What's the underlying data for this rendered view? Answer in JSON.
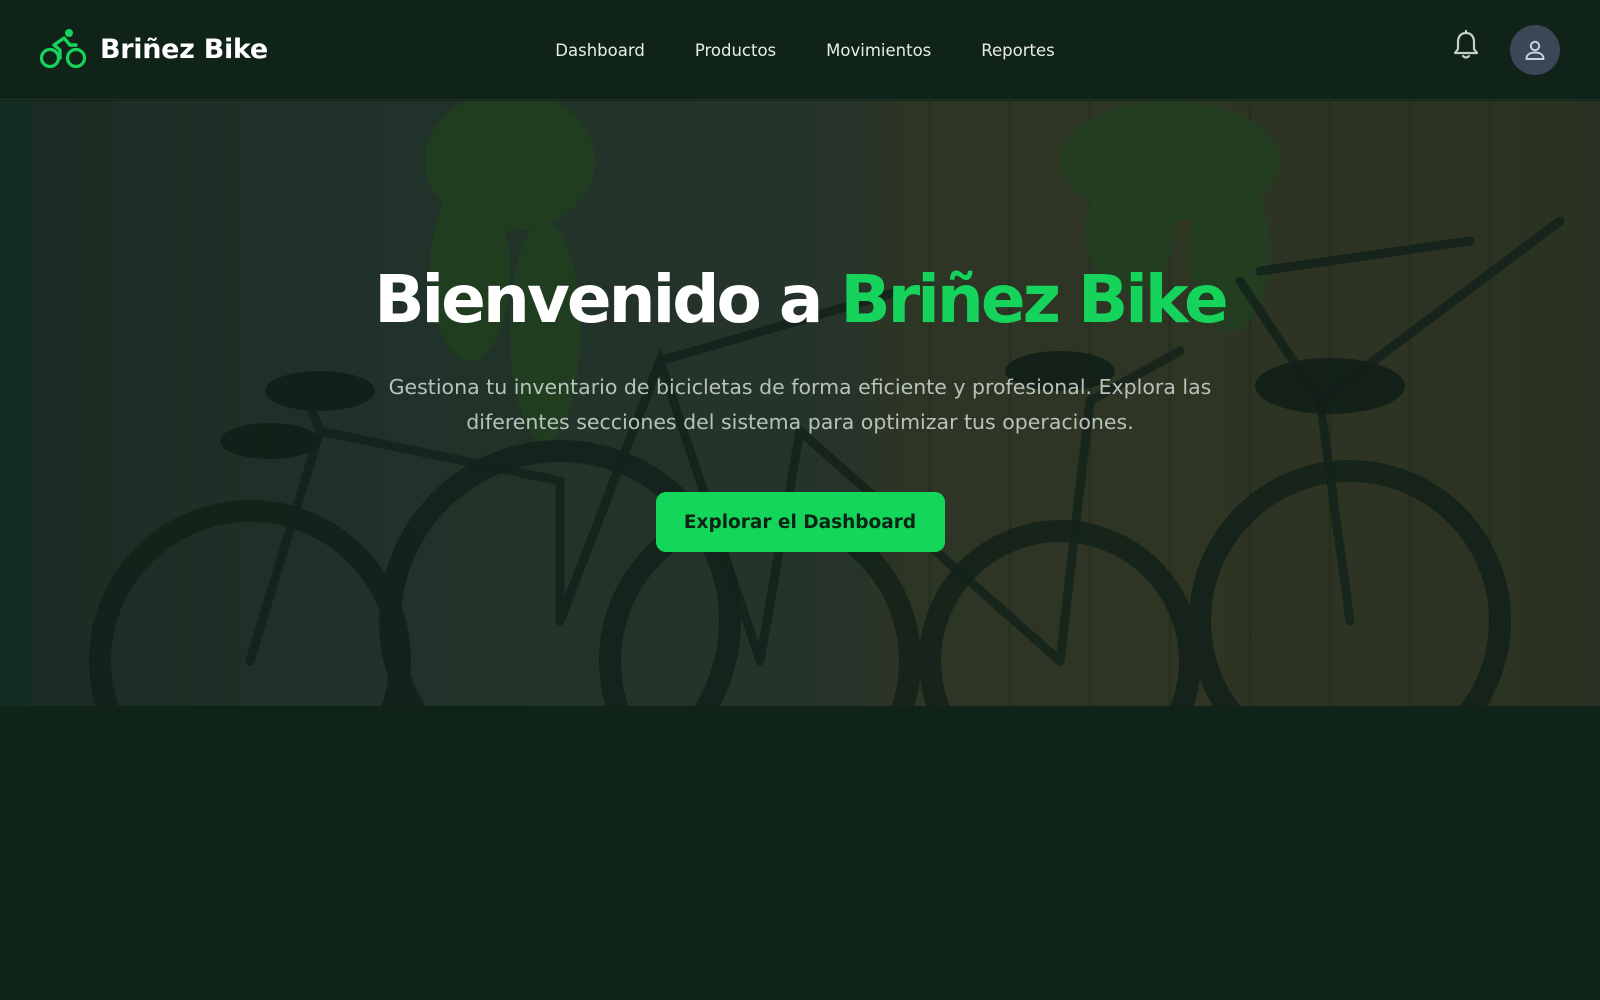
{
  "brand": {
    "name": "Briñez Bike",
    "icon": "bicycle-rider-icon",
    "accent_color": "#16d35c"
  },
  "nav": {
    "items": [
      {
        "label": "Dashboard"
      },
      {
        "label": "Productos"
      },
      {
        "label": "Movimientos"
      },
      {
        "label": "Reportes"
      }
    ]
  },
  "header_actions": {
    "notifications_icon": "bell-icon",
    "user_icon": "user-icon"
  },
  "hero": {
    "title_prefix": "Bienvenido a",
    "title_highlight": "Briñez Bike",
    "subtitle": "Gestiona tu inventario de bicicletas de forma eficiente y profesional. Explora las diferentes secciones del sistema para optimizar tus operaciones.",
    "cta_label": "Explorar el Dashboard"
  },
  "colors": {
    "background": "#0f2318",
    "primary": "#14d65a",
    "avatar_bg": "#3b4757"
  }
}
